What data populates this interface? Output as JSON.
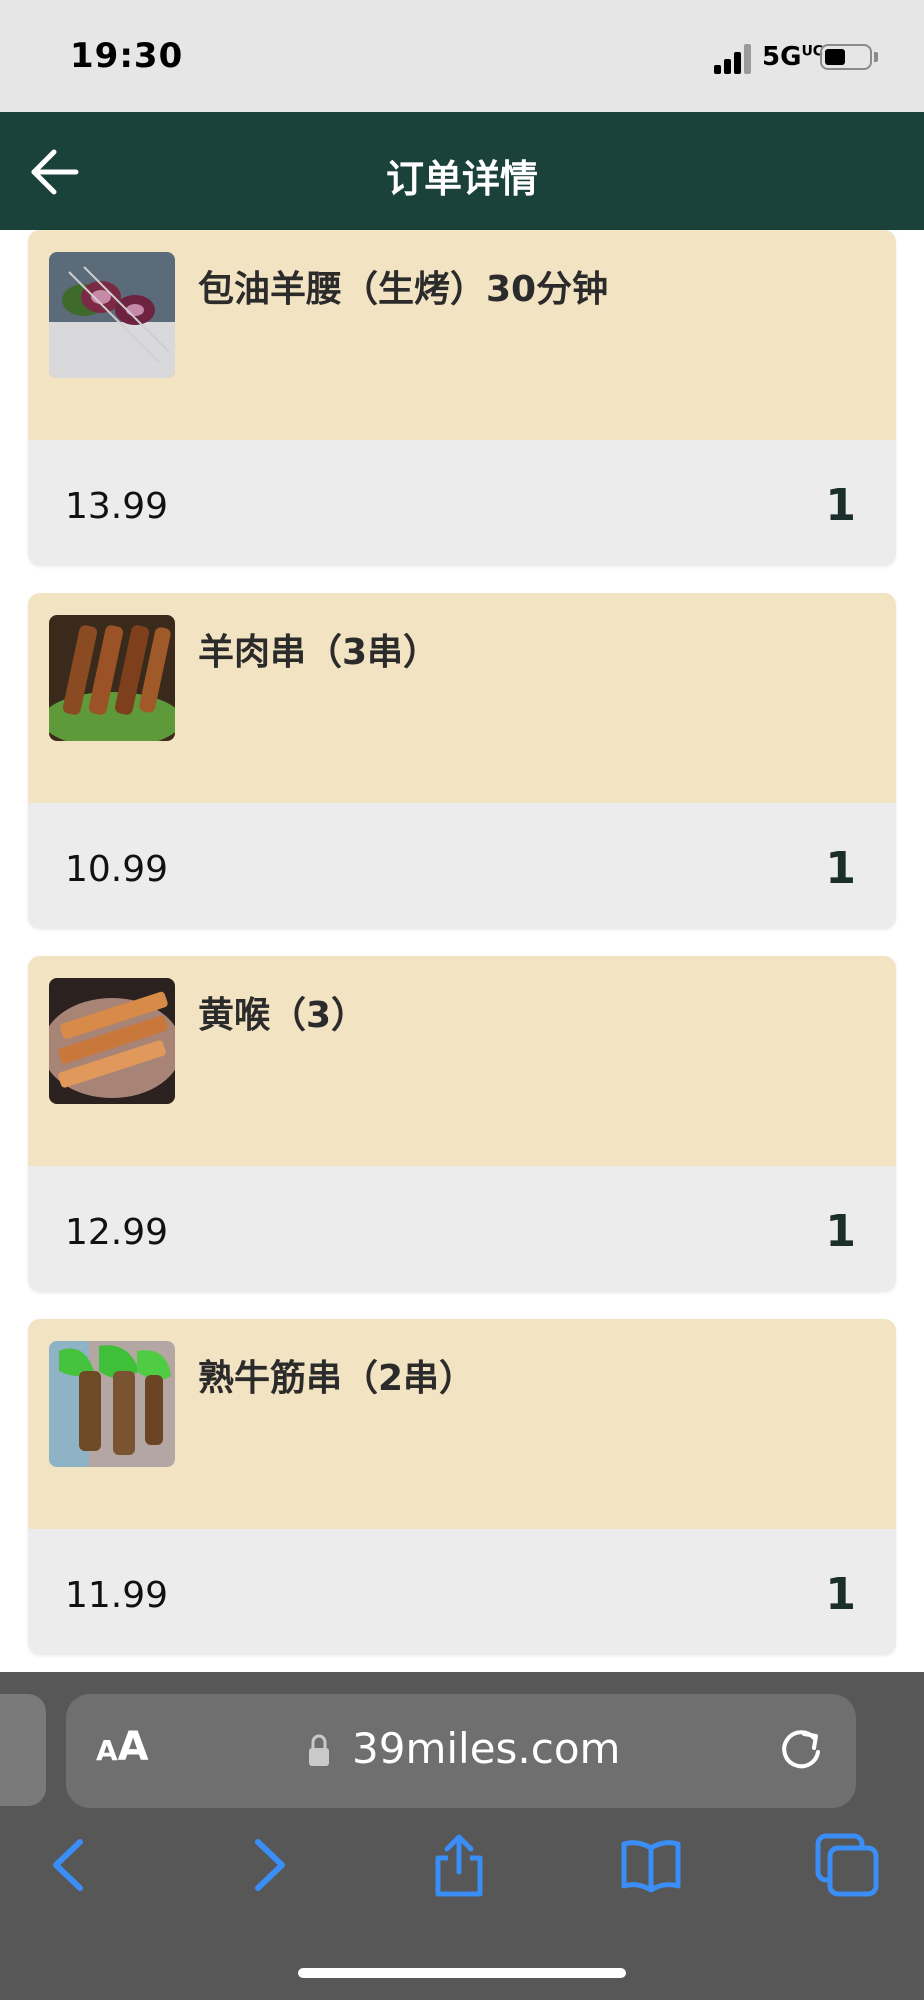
{
  "status_bar": {
    "time": "19:30",
    "network": "5G",
    "network_sup": "UC"
  },
  "header": {
    "title": "订单详情",
    "back_icon": "arrow-left-icon"
  },
  "orders": [
    {
      "name": "包油羊腰（生烤）30分钟",
      "price": "13.99",
      "qty": "1",
      "image": "lamb-kidney-skewer-photo"
    },
    {
      "name": "羊肉串（3串）",
      "price": "10.99",
      "qty": "1",
      "image": "lamb-skewers-photo"
    },
    {
      "name": "黄喉（3）",
      "price": "12.99",
      "qty": "1",
      "image": "aorta-skewers-photo"
    },
    {
      "name": "熟牛筋串（2串）",
      "price": "11.99",
      "qty": "1",
      "image": "beef-tendon-skewers-photo"
    }
  ],
  "browser": {
    "aa_big": "A",
    "aa_small": "A",
    "url": "39miles.com",
    "icons": [
      "back-icon",
      "forward-icon",
      "share-icon",
      "bookmarks-icon",
      "tabs-icon"
    ]
  },
  "colors": {
    "header": "#1b413b",
    "card_top": "#f2e3c3",
    "card_bottom": "#ececec",
    "toolbar": "#575757",
    "accent": "#3a8ef5"
  }
}
